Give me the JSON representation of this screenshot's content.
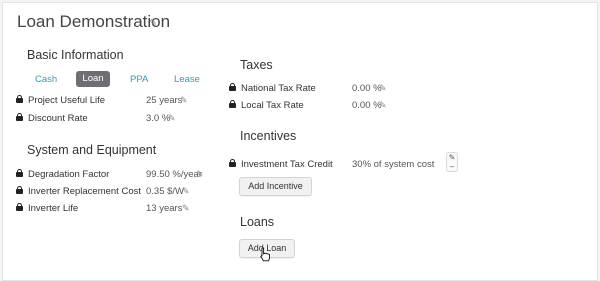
{
  "page": {
    "title": "Loan Demonstration",
    "title_edit_icon": "pencil-icon"
  },
  "basic": {
    "heading": "Basic Information",
    "tabs": [
      {
        "label": "Cash",
        "active": false
      },
      {
        "label": "Loan",
        "active": true
      },
      {
        "label": "PPA",
        "active": false
      },
      {
        "label": "Lease",
        "active": false
      }
    ],
    "rows": [
      {
        "label": "Project Useful Life",
        "value": "25 years"
      },
      {
        "label": "Discount Rate",
        "value": "3.0 %"
      }
    ]
  },
  "system": {
    "heading": "System and Equipment",
    "rows": [
      {
        "label": "Degradation Factor",
        "value": "99.50 %/year"
      },
      {
        "label": "Inverter Replacement Cost",
        "value": "0.35 $/W"
      },
      {
        "label": "Inverter Life",
        "value": "13 years"
      }
    ]
  },
  "taxes": {
    "heading": "Taxes",
    "rows": [
      {
        "label": "National Tax Rate",
        "value": "0.00 %"
      },
      {
        "label": "Local Tax Rate",
        "value": "0.00 %"
      }
    ]
  },
  "incentives": {
    "heading": "Incentives",
    "rows": [
      {
        "label": "Investment Tax Credit",
        "value": "30% of system cost"
      }
    ],
    "add_label": "Add Incentive",
    "remove_symbol": "–"
  },
  "loans": {
    "heading": "Loans",
    "add_label": "Add Loan"
  },
  "icons": {
    "edit": "✎",
    "lock": "lock-icon",
    "cursor": "hand-pointer-icon"
  },
  "colors": {
    "accent": "#2a9fb0",
    "active_tab_bg": "#6d6f72"
  }
}
